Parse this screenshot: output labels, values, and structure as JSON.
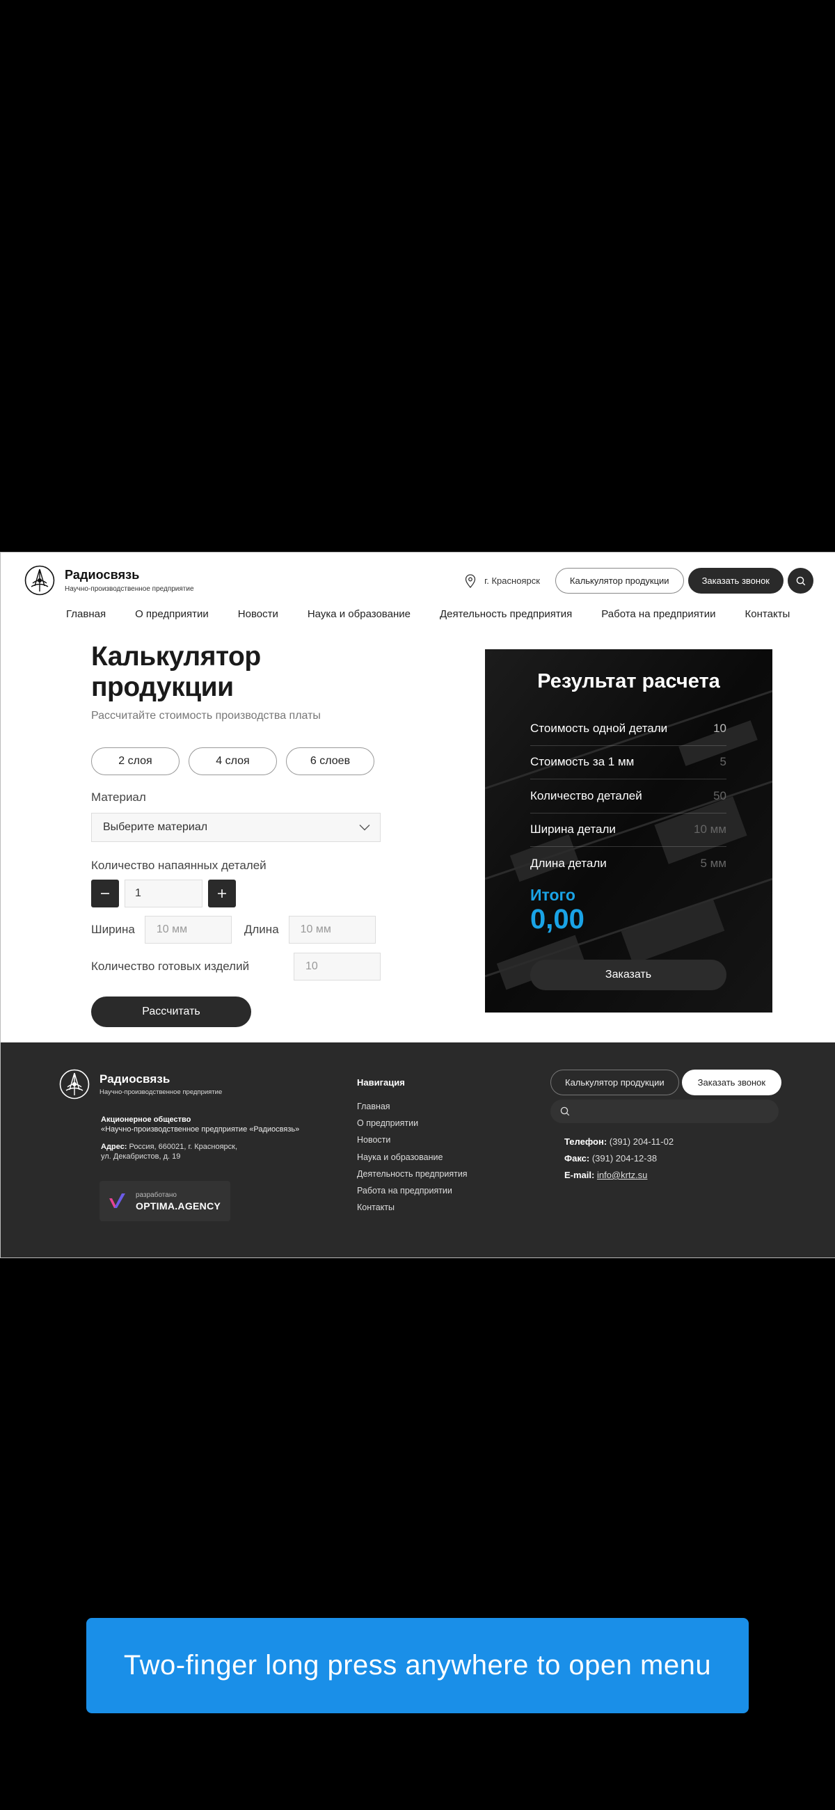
{
  "header": {
    "brand": "Радиосвязь",
    "brand_sub": "Научно-производственное предприятие",
    "city": "г. Красноярск",
    "calc_button": "Калькулятор продукции",
    "callback_button": "Заказать звонок"
  },
  "nav": [
    "Главная",
    "О предприятии",
    "Новости",
    "Наука и образование",
    "Деятельность предприятия",
    "Работа на предприятии",
    "Контакты"
  ],
  "calculator": {
    "title": "Калькулятор продукции",
    "subtitle": "Рассчитайте стоимость производства платы",
    "layers": [
      "2 слоя",
      "4 слоя",
      "6 слоев"
    ],
    "material_label": "Материал",
    "material_placeholder": "Выберите материал",
    "qty_label": "Количество напаянных деталей",
    "qty_value": "1",
    "width_label": "Ширина",
    "width_placeholder": "10 мм",
    "length_label": "Длина",
    "length_placeholder": "10 мм",
    "count_label": "Количество готовых изделий",
    "count_placeholder": "10",
    "submit": "Рассчитать"
  },
  "result": {
    "title": "Результат расчета",
    "rows": [
      {
        "label": "Стоимость одной детали",
        "value": "10"
      },
      {
        "label": "Стоимость за 1 мм",
        "value": "5"
      },
      {
        "label": "Количество деталей",
        "value": "50"
      },
      {
        "label": "Ширина детали",
        "value": "10 мм"
      },
      {
        "label": "Длина детали",
        "value": "5 мм"
      }
    ],
    "total_label": "Итого",
    "total_value": "0,00",
    "order_button": "Заказать",
    "accent_color": "#1aa3e6"
  },
  "footer": {
    "brand": "Радиосвязь",
    "brand_sub": "Научно-производственное предприятие",
    "company_line1": "Акционерное общество",
    "company_line2": "«Научно-производственное предприятие «Радиосвязь»",
    "address_label": "Адрес:",
    "address_line1": " Россия, 660021, г. Красноярск,",
    "address_line2": "ул. Декабристов, д. 19",
    "dev_small": "разработано",
    "dev_big": "OPTIMA.AGENCY",
    "nav_title": "Навигация",
    "nav": [
      "Главная",
      "О предприятии",
      "Новости",
      "Наука и образование",
      "Деятельность предприятия",
      "Работа на предприятии",
      "Контакты"
    ],
    "calc_button": "Калькулятор продукции",
    "callback_button": "Заказать звонок",
    "phone_label": "Телефон:",
    "phone": " (391) 204-11-02",
    "fax_label": "Факс:",
    "fax": " (391) 204-12-38",
    "email_label": "E-mail:",
    "email": "info@krtz.su"
  },
  "toast": "Two-finger long press anywhere to open menu"
}
